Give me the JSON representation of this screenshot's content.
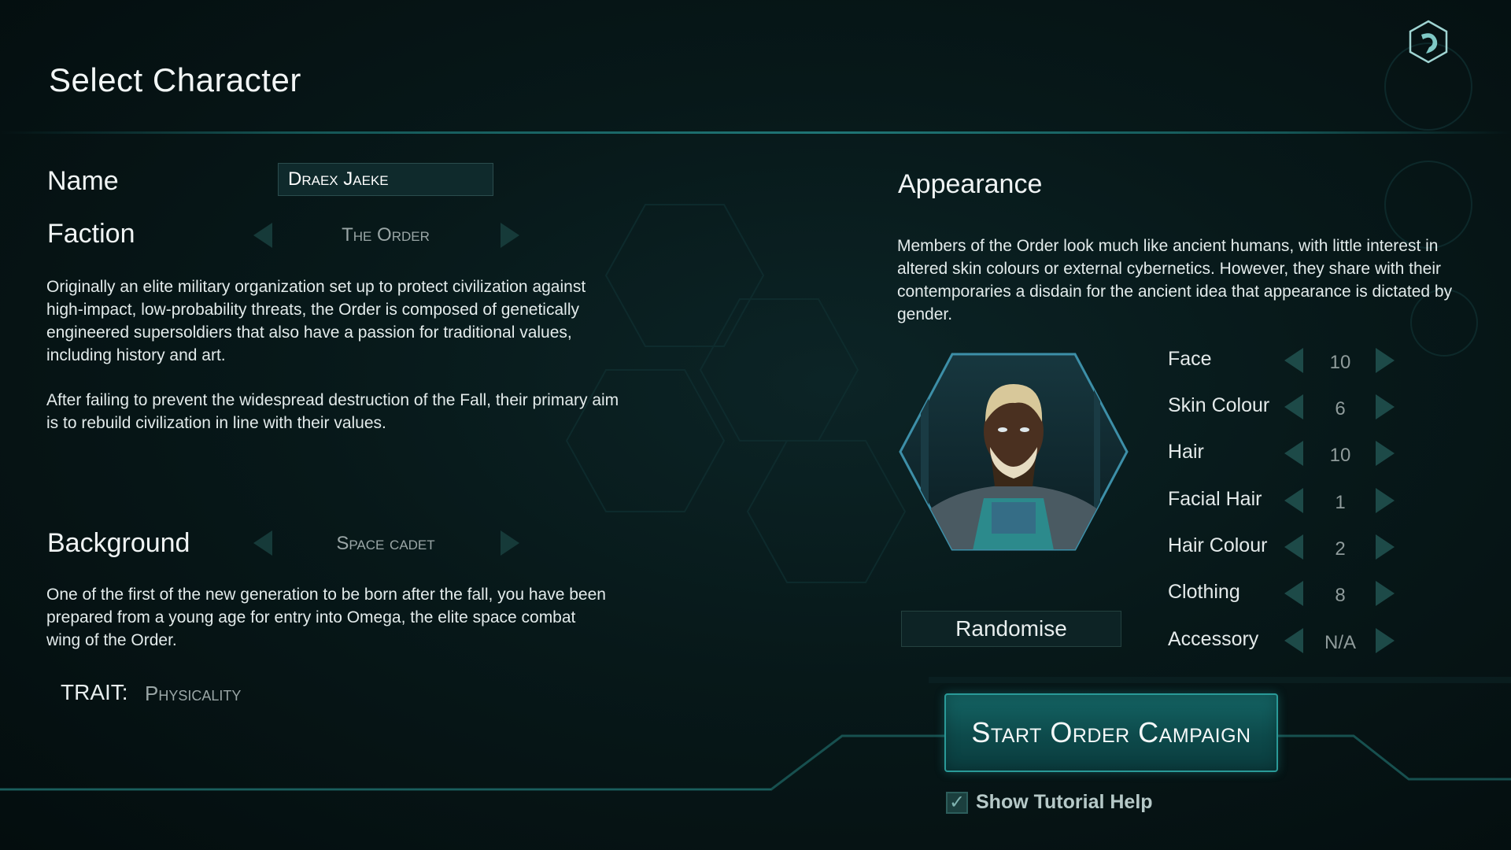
{
  "header": {
    "title": "Select Character"
  },
  "character": {
    "name_label": "Name",
    "name_value": "Draex Jaeke",
    "faction_label": "Faction",
    "faction_value": "The Order",
    "faction_description_1": "Originally an elite military organization set up to protect civilization against high-impact, low-probability threats, the Order is composed of genetically engineered supersoldiers that also have a passion for traditional values, including history and art.",
    "faction_description_2": "After failing to prevent the widespread destruction of the Fall, their primary aim is to rebuild civilization in line with their values.",
    "background_label": "Background",
    "background_value": "Space cadet",
    "background_description": "One of the first of the new generation to be born after the fall, you have been prepared from a young age for entry into Omega, the elite space combat wing of the Order.",
    "trait_label": "TRAIT:",
    "trait_value": "Physicality"
  },
  "appearance": {
    "title": "Appearance",
    "description": "Members of the Order look much like ancient humans, with little interest in altered skin colours or external cybernetics. However, they share with their contemporaries a disdain for the ancient idea that appearance is dictated by gender.",
    "randomise_label": "Randomise",
    "options": [
      {
        "label": "Face",
        "value": "10"
      },
      {
        "label": "Skin Colour",
        "value": "6"
      },
      {
        "label": "Hair",
        "value": "10"
      },
      {
        "label": "Facial Hair",
        "value": "1"
      },
      {
        "label": "Hair Colour",
        "value": "2"
      },
      {
        "label": "Clothing",
        "value": "8"
      },
      {
        "label": "Accessory",
        "value": "N/A"
      }
    ]
  },
  "actions": {
    "start_label": "Start Order Campaign",
    "tutorial_label": "Show Tutorial Help",
    "tutorial_checked": true
  },
  "colors": {
    "accent": "#1f7575",
    "button": "#146464",
    "arrow": "#1d4a48"
  }
}
